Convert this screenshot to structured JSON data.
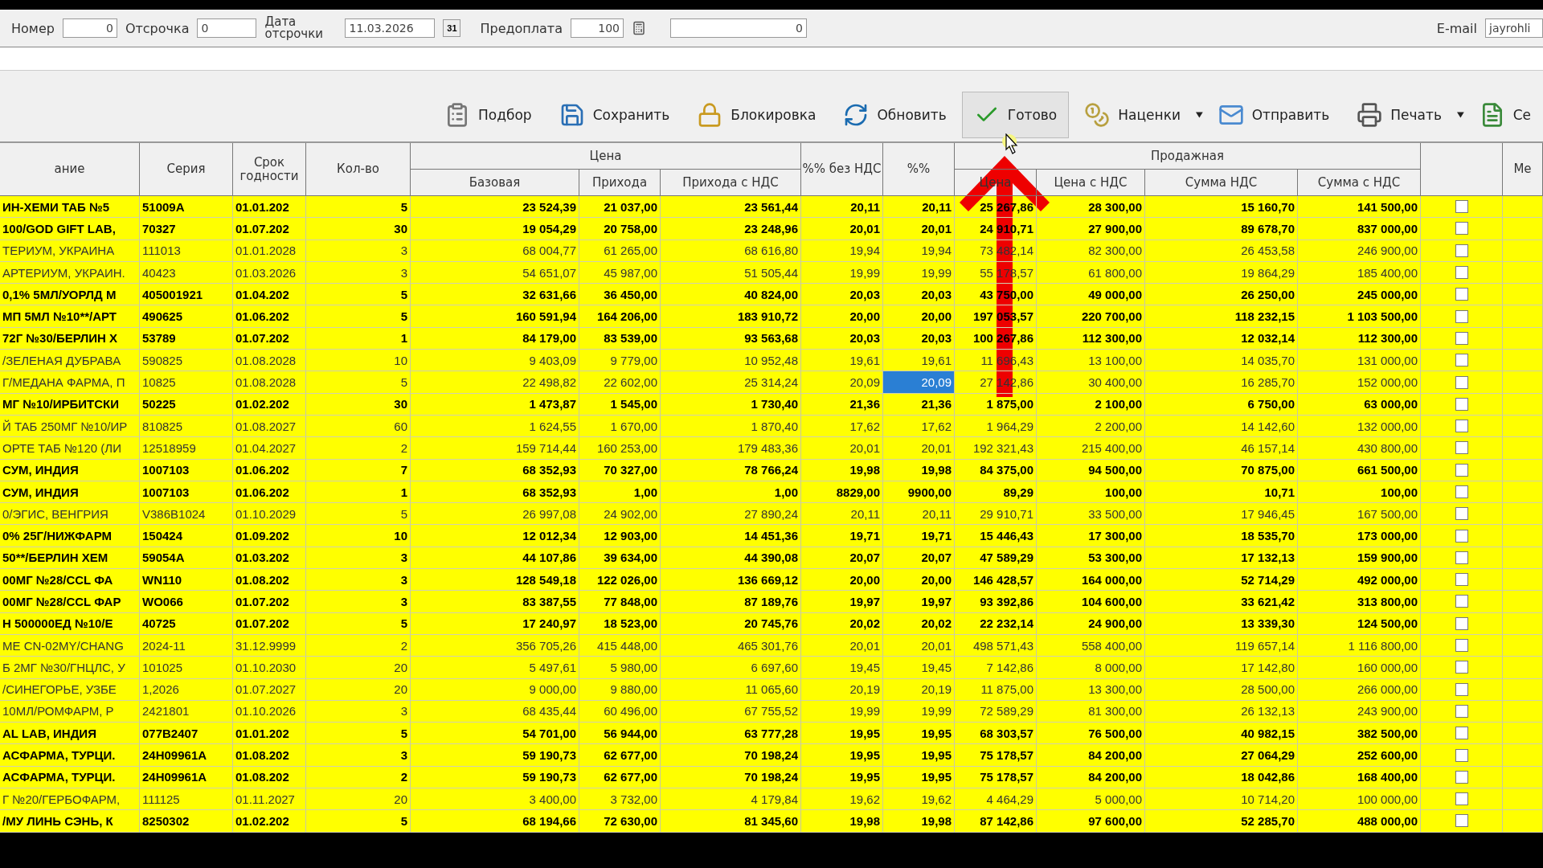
{
  "form": {
    "number_label": "Номер",
    "number_value": "0",
    "delay_label": "Отсрочка",
    "delay_value": "0",
    "delay_date_label": "Дата отсрочки",
    "delay_date_value": "11.03.2026",
    "calendar_button": "31",
    "prepay_label": "Предоплата",
    "prepay_value": "100",
    "amount_value": "0",
    "email_label": "E-mail",
    "email_value": "jayrohli"
  },
  "toolbar": [
    {
      "label": "Подбор",
      "kind": "list",
      "pressed": false,
      "menu": false
    },
    {
      "label": "Сохранить",
      "kind": "save",
      "pressed": false,
      "menu": false
    },
    {
      "label": "Блокировка",
      "kind": "lock",
      "pressed": false,
      "menu": false
    },
    {
      "label": "Обновить",
      "kind": "refresh",
      "pressed": false,
      "menu": false
    },
    {
      "label": "Готово",
      "kind": "check",
      "pressed": true,
      "menu": false
    },
    {
      "label": "Наценки",
      "kind": "coins",
      "pressed": false,
      "menu": true
    },
    {
      "label": "Отправить",
      "kind": "mail",
      "pressed": false,
      "menu": false
    },
    {
      "label": "Печать",
      "kind": "printer",
      "pressed": false,
      "menu": true
    },
    {
      "label": "Се",
      "kind": "doc",
      "pressed": false,
      "menu": false
    }
  ],
  "table": {
    "column_groups": [
      {
        "label": "Цена"
      },
      {
        "label": "Продажная"
      }
    ],
    "columns": [
      {
        "label": "ание",
        "grouped": false
      },
      {
        "label": "Серия",
        "grouped": false
      },
      {
        "label": "Срок годности",
        "grouped": false
      },
      {
        "label": "Кол-во",
        "grouped": false
      },
      {
        "label": "Базовая",
        "grouped": true
      },
      {
        "label": "Прихода",
        "grouped": true
      },
      {
        "label": "Прихода с НДС",
        "grouped": true
      },
      {
        "label": "%% без НДС",
        "grouped": false
      },
      {
        "label": "%%",
        "grouped": false
      },
      {
        "label": "Цена",
        "grouped": true
      },
      {
        "label": "Цена с НДС",
        "grouped": true
      },
      {
        "label": "Сумма НДС",
        "grouped": true
      },
      {
        "label": "Сумма с НДС",
        "grouped": true
      },
      {
        "grouped": false
      },
      {
        "label": "Ме",
        "grouped": false
      }
    ],
    "rows": [
      {
        "emphasized": true,
        "pct_selected": false,
        "checked": false,
        "cells": [
          "ИН-ХЕМИ ТАБ №5",
          "51009A",
          "01.01.202",
          "5",
          "23 524,39",
          "21 037,00",
          "23 561,44",
          "20,11",
          "20,11",
          "25 267,86",
          "28 300,00",
          "15 160,70",
          "141 500,00"
        ]
      },
      {
        "emphasized": true,
        "pct_selected": false,
        "checked": false,
        "cells": [
          "100/GOD GIFT LAB,",
          "70327",
          "01.07.202",
          "30",
          "19 054,29",
          "20 758,00",
          "23 248,96",
          "20,01",
          "20,01",
          "24 910,71",
          "27 900,00",
          "89 678,70",
          "837 000,00"
        ]
      },
      {
        "emphasized": false,
        "pct_selected": false,
        "checked": false,
        "cells": [
          "ТЕРИУМ, УКРАИНА",
          "111013",
          "01.01.2028",
          "3",
          "68 004,77",
          "61 265,00",
          "68 616,80",
          "19,94",
          "19,94",
          "73 482,14",
          "82 300,00",
          "26 453,58",
          "246 900,00"
        ]
      },
      {
        "emphasized": false,
        "pct_selected": false,
        "checked": false,
        "cells": [
          "АРТЕРИУМ, УКРАИН.",
          "40423",
          "01.03.2026",
          "3",
          "54 651,07",
          "45 987,00",
          "51 505,44",
          "19,99",
          "19,99",
          "55 178,57",
          "61 800,00",
          "19 864,29",
          "185 400,00"
        ]
      },
      {
        "emphasized": true,
        "pct_selected": false,
        "checked": false,
        "cells": [
          "0,1% 5МЛ/УОРЛД М",
          "405001921",
          "01.04.202",
          "5",
          "32 631,66",
          "36 450,00",
          "40 824,00",
          "20,03",
          "20,03",
          "43 750,00",
          "49 000,00",
          "26 250,00",
          "245 000,00"
        ]
      },
      {
        "emphasized": true,
        "pct_selected": false,
        "checked": false,
        "cells": [
          "МП 5МЛ №10**/АРТ",
          "490625",
          "01.06.202",
          "5",
          "160 591,94",
          "164 206,00",
          "183 910,72",
          "20,00",
          "20,00",
          "197 053,57",
          "220 700,00",
          "118 232,15",
          "1 103 500,00"
        ]
      },
      {
        "emphasized": true,
        "pct_selected": false,
        "checked": false,
        "cells": [
          "72Г №30/БЕРЛИН Х",
          "53789",
          "01.07.202",
          "1",
          "84 179,00",
          "83 539,00",
          "93 563,68",
          "20,03",
          "20,03",
          "100 267,86",
          "112 300,00",
          "12 032,14",
          "112 300,00"
        ]
      },
      {
        "emphasized": false,
        "pct_selected": false,
        "checked": false,
        "cells": [
          "/ЗЕЛЕНАЯ ДУБРАВА",
          "590825",
          "01.08.2028",
          "10",
          "9 403,09",
          "9 779,00",
          "10 952,48",
          "19,61",
          "19,61",
          "11 696,43",
          "13 100,00",
          "14 035,70",
          "131 000,00"
        ]
      },
      {
        "emphasized": false,
        "pct_selected": true,
        "checked": false,
        "cells": [
          "Г/МЕДАНА ФАРМА, П",
          "10825",
          "01.08.2028",
          "5",
          "22 498,82",
          "22 602,00",
          "25 314,24",
          "20,09",
          "20,09",
          "27 142,86",
          "30 400,00",
          "16 285,70",
          "152 000,00"
        ]
      },
      {
        "emphasized": true,
        "pct_selected": false,
        "checked": false,
        "cells": [
          "МГ №10/ИРБИТСКИ",
          "50225",
          "01.02.202",
          "30",
          "1 473,87",
          "1 545,00",
          "1 730,40",
          "21,36",
          "21,36",
          "1 875,00",
          "2 100,00",
          "6 750,00",
          "63 000,00"
        ]
      },
      {
        "emphasized": false,
        "pct_selected": false,
        "checked": false,
        "cells": [
          "Й ТАБ 250МГ №10/ИР",
          "810825",
          "01.08.2027",
          "60",
          "1 624,55",
          "1 670,00",
          "1 870,40",
          "17,62",
          "17,62",
          "1 964,29",
          "2 200,00",
          "14 142,60",
          "132 000,00"
        ]
      },
      {
        "emphasized": false,
        "pct_selected": false,
        "checked": false,
        "cells": [
          "ОРТЕ ТАБ №120 (ЛИ",
          "12518959",
          "01.04.2027",
          "2",
          "159 714,44",
          "160 253,00",
          "179 483,36",
          "20,01",
          "20,01",
          "192 321,43",
          "215 400,00",
          "46 157,14",
          "430 800,00"
        ]
      },
      {
        "emphasized": true,
        "pct_selected": false,
        "checked": false,
        "cells": [
          "СУМ, ИНДИЯ",
          "1007103",
          "01.06.202",
          "7",
          "68 352,93",
          "70 327,00",
          "78 766,24",
          "19,98",
          "19,98",
          "84 375,00",
          "94 500,00",
          "70 875,00",
          "661 500,00"
        ]
      },
      {
        "emphasized": true,
        "pct_selected": false,
        "checked": false,
        "cells": [
          "СУМ, ИНДИЯ",
          "1007103",
          "01.06.202",
          "1",
          "68 352,93",
          "1,00",
          "1,00",
          "8829,00",
          "9900,00",
          "89,29",
          "100,00",
          "10,71",
          "100,00"
        ]
      },
      {
        "emphasized": false,
        "pct_selected": false,
        "checked": false,
        "cells": [
          "0/ЭГИС, ВЕНГРИЯ",
          "V386B1024",
          "01.10.2029",
          "5",
          "26 997,08",
          "24 902,00",
          "27 890,24",
          "20,11",
          "20,11",
          "29 910,71",
          "33 500,00",
          "17 946,45",
          "167 500,00"
        ]
      },
      {
        "emphasized": true,
        "pct_selected": false,
        "checked": false,
        "cells": [
          "0% 25Г/НИЖФАРМ",
          "150424",
          "01.09.202",
          "10",
          "12 012,34",
          "12 903,00",
          "14 451,36",
          "19,71",
          "19,71",
          "15 446,43",
          "17 300,00",
          "18 535,70",
          "173 000,00"
        ]
      },
      {
        "emphasized": true,
        "pct_selected": false,
        "checked": false,
        "cells": [
          "50**/БЕРЛИН ХЕМ",
          "59054A",
          "01.03.202",
          "3",
          "44 107,86",
          "39 634,00",
          "44 390,08",
          "20,07",
          "20,07",
          "47 589,29",
          "53 300,00",
          "17 132,13",
          "159 900,00"
        ]
      },
      {
        "emphasized": true,
        "pct_selected": false,
        "checked": false,
        "cells": [
          "00МГ №28/CCL ФА",
          "WN110",
          "01.08.202",
          "3",
          "128 549,18",
          "122 026,00",
          "136 669,12",
          "20,00",
          "20,00",
          "146 428,57",
          "164 000,00",
          "52 714,29",
          "492 000,00"
        ]
      },
      {
        "emphasized": true,
        "pct_selected": false,
        "checked": false,
        "cells": [
          "00МГ №28/CCL ФАР",
          "WO066",
          "01.07.202",
          "3",
          "83 387,55",
          "77 848,00",
          "87 189,76",
          "19,97",
          "19,97",
          "93 392,86",
          "104 600,00",
          "33 621,42",
          "313 800,00"
        ]
      },
      {
        "emphasized": true,
        "pct_selected": false,
        "checked": false,
        "cells": [
          "Н 500000ЕД №10/Е",
          "40725",
          "01.07.202",
          "5",
          "17 240,97",
          "18 523,00",
          "20 745,76",
          "20,02",
          "20,02",
          "22 232,14",
          "24 900,00",
          "13 339,30",
          "124 500,00"
        ]
      },
      {
        "emphasized": false,
        "pct_selected": false,
        "checked": false,
        "cells": [
          "МЕ CN-02MY/CHANG",
          "2024-11",
          "31.12.9999",
          "2",
          "356 705,26",
          "415 448,00",
          "465 301,76",
          "20,01",
          "20,01",
          "498 571,43",
          "558 400,00",
          "119 657,14",
          "1 116 800,00"
        ]
      },
      {
        "emphasized": false,
        "pct_selected": false,
        "checked": false,
        "cells": [
          "Б 2МГ №30/ГНЦЛС, У",
          "101025",
          "01.10.2030",
          "20",
          "5 497,61",
          "5 980,00",
          "6 697,60",
          "19,45",
          "19,45",
          "7 142,86",
          "8 000,00",
          "17 142,80",
          "160 000,00"
        ]
      },
      {
        "emphasized": false,
        "pct_selected": false,
        "checked": false,
        "cells": [
          "/СИНЕГОРЬЕ, УЗБЕ",
          "1,2026",
          "01.07.2027",
          "20",
          "9 000,00",
          "9 880,00",
          "11 065,60",
          "20,19",
          "20,19",
          "11 875,00",
          "13 300,00",
          "28 500,00",
          "266 000,00"
        ]
      },
      {
        "emphasized": false,
        "pct_selected": false,
        "checked": false,
        "cells": [
          "10МЛ/РОМФАРМ, Р",
          "2421801",
          "01.10.2026",
          "3",
          "68 435,44",
          "60 496,00",
          "67 755,52",
          "19,99",
          "19,99",
          "72 589,29",
          "81 300,00",
          "26 132,13",
          "243 900,00"
        ]
      },
      {
        "emphasized": true,
        "pct_selected": false,
        "checked": false,
        "cells": [
          "AL LAB, ИНДИЯ",
          "077B2407",
          "01.01.202",
          "5",
          "54 701,00",
          "56 944,00",
          "63 777,28",
          "19,95",
          "19,95",
          "68 303,57",
          "76 500,00",
          "40 982,15",
          "382 500,00"
        ]
      },
      {
        "emphasized": true,
        "pct_selected": false,
        "checked": false,
        "cells": [
          "АСФАРМА, ТУРЦИ.",
          "24H09961A",
          "01.08.202",
          "3",
          "59 190,73",
          "62 677,00",
          "70 198,24",
          "19,95",
          "19,95",
          "75 178,57",
          "84 200,00",
          "27 064,29",
          "252 600,00"
        ]
      },
      {
        "emphasized": true,
        "pct_selected": false,
        "checked": false,
        "cells": [
          "АСФАРМА, ТУРЦИ.",
          "24H09961A",
          "01.08.202",
          "2",
          "59 190,73",
          "62 677,00",
          "70 198,24",
          "19,95",
          "19,95",
          "75 178,57",
          "84 200,00",
          "18 042,86",
          "168 400,00"
        ]
      },
      {
        "emphasized": false,
        "pct_selected": false,
        "checked": false,
        "cells": [
          "Г №20/ГЕРБОФАРМ,",
          "111125",
          "01.11.2027",
          "20",
          "3 400,00",
          "3 732,00",
          "4 179,84",
          "19,62",
          "19,62",
          "4 464,29",
          "5 000,00",
          "10 714,20",
          "100 000,00"
        ]
      },
      {
        "emphasized": true,
        "pct_selected": false,
        "checked": false,
        "cells": [
          "/МУ ЛИНЬ СЭНЬ, К",
          "8250302",
          "01.02.202",
          "5",
          "68 194,66",
          "72 630,00",
          "81 345,60",
          "19,98",
          "19,98",
          "87 142,86",
          "97 600,00",
          "52 285,70",
          "488 000,00"
        ]
      }
    ]
  }
}
